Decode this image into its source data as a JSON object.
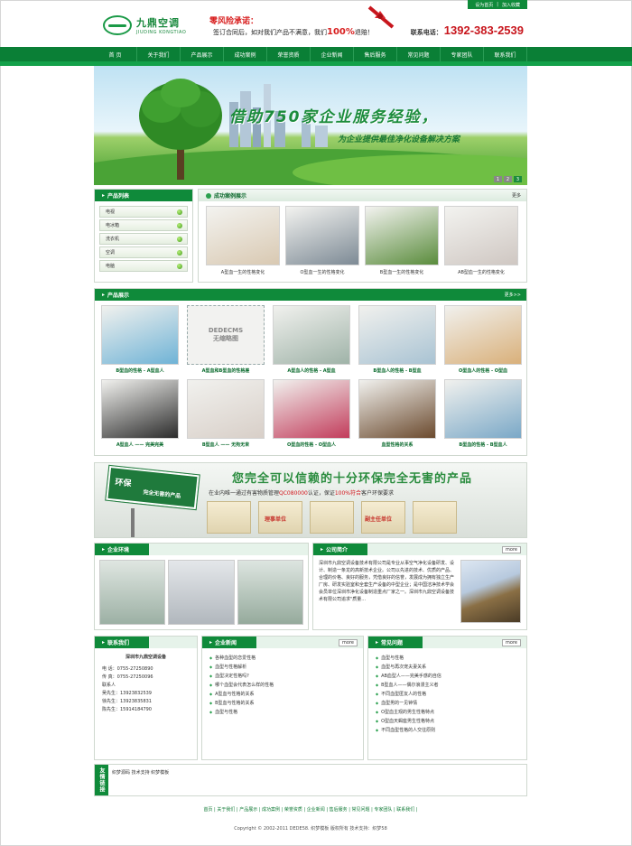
{
  "top_links": [
    "设为首页",
    "加入收藏"
  ],
  "logo": {
    "cn": "九鼎空调",
    "en": "JIUDING KONGTIAO"
  },
  "promise": {
    "title": "零风险承诺：",
    "text_before": "签订合同后，如对我们产品不满意，我们",
    "highlight": "100%",
    "text_after": "退赔！"
  },
  "hotline": {
    "label": "联系电话：",
    "number": "1392-383-2539"
  },
  "nav": [
    "首 页",
    "关于我们",
    "产品展示",
    "成功案例",
    "荣誉资质",
    "企业新闻",
    "售后服务",
    "常见问题",
    "专家团队",
    "联系我们"
  ],
  "banner": {
    "title": "借助750家企业服务经验，",
    "subtitle": "为企业提供最佳净化设备解决方案",
    "dots": [
      "1",
      "2",
      "3"
    ]
  },
  "categories": {
    "title": "产品列表",
    "items": [
      "电视",
      "电冰箱",
      "洗衣机",
      "空调",
      "电脑"
    ]
  },
  "cases": {
    "title": "成功案例展示",
    "more": "更多",
    "items": [
      {
        "caption": "A型血一生的性格变化",
        "color": "#d9c9b2"
      },
      {
        "caption": "O型血一生的性格变化",
        "color": "#7d8a95"
      },
      {
        "caption": "B型血一生的性格变化",
        "color": "#5a8c3c"
      },
      {
        "caption": "AB型血一生的性格变化",
        "color": "#cfc7c2"
      }
    ]
  },
  "products": {
    "title": "产品展示",
    "more": "更多>>",
    "items": [
      {
        "caption": "B型血的性格 - A型血人",
        "color": "#6fb3d6"
      },
      {
        "caption": "A型血和B型血的性格差",
        "color": "",
        "placeholder": [
          "DEDECMS",
          "无缩略图"
        ]
      },
      {
        "caption": "A型血人的性格 - A型血",
        "color": "#9fb3a8"
      },
      {
        "caption": "B型血人的性格 - B型血",
        "color": "#a9c3d3"
      },
      {
        "caption": "O型血人的性格 - O型血",
        "color": "#d9b07a"
      },
      {
        "caption": "A型血人 —— 完美完美",
        "color": "#2b2b2b"
      },
      {
        "caption": "B型血人 —— 无拘无束",
        "color": "#d8cfc8"
      },
      {
        "caption": "O型血的性格 - O型血人",
        "color": "#c23c5b"
      },
      {
        "caption": "血型性格的关系",
        "color": "#6b4a2e"
      },
      {
        "caption": "B型血的性格 - B型血人",
        "color": "#7aa8c7"
      }
    ]
  },
  "ad": {
    "title": "您完全可以信赖的十分环保完全无害的产品",
    "text_before": "在业内唯一通过有害物质管理",
    "red1": "QC080000",
    "text_mid": "认证，保证",
    "red2": "100%符合",
    "text_after": "客户环保要求",
    "sign_title": "环保",
    "sign_sub": "完全无害的产品",
    "certs": [
      "",
      "理事单位",
      "",
      "副主任单位",
      ""
    ]
  },
  "environment": {
    "title": "企业环境",
    "more": ""
  },
  "intro": {
    "title": "公司简介",
    "more": "more",
    "text": "深圳市九鼎空调设备技术有限公司是专业从事空气净化设备研发、设计、制造一条龙的高新技术企业。公司以先进的技术、优质的产品、合理的价格、良好的服务，凭借良好的信誉，发展成为拥有独立生产厂房、研发实验室和全套生产设备的中型企业；是中国洁净技术学会会员单位深圳市净化设备制造重点厂家之一。深圳市九鼎空调设备技术有限公司追求\"质量..."
  },
  "contact": {
    "title": "联系我们",
    "company": "深圳市九鼎空调设备",
    "lines": [
      "电  话：0755-27250890",
      "传  真：0755-27250096",
      "联系人",
      "吴先生：13923832539",
      "徐先生：13923835831",
      "陈先生：15914184790"
    ]
  },
  "news": {
    "title": "企业新闻",
    "more": "more",
    "items": [
      "各种血型的恋爱性格",
      "血型与性格解析",
      "血型决定性格吗?",
      "哪个血型会代表怎么样的性格",
      "A型血与性格的关系",
      "B型血与性格的关系",
      "血型与性格"
    ]
  },
  "faq": {
    "title": "常见问题",
    "more": "more",
    "items": [
      "血型与性格",
      "血型与再次宠夫妻关系",
      "AB血型人——完美手感的自信",
      "B型血人——偶尔浪漫主义者",
      "不同血型匿友人的性格",
      "血型男的一见钟情",
      "O型血主观的男生性格特点",
      "O型血天蝎座男生性格特点",
      "不同血型性格的人交往原则"
    ]
  },
  "links": {
    "tag": "友情链接",
    "text": "织梦源码  技术支持  织梦模板"
  },
  "footer_nav": "首页 | 关于我们 | 产品展示 | 成功案例 | 荣誉资质 | 企业新闻 | 售后服务 | 常见问题 | 专家团队 | 联系我们 |",
  "copyright": "Copyright © 2002-2011 DEDE58. 织梦模板 版权所有    技术支持：织梦58"
}
